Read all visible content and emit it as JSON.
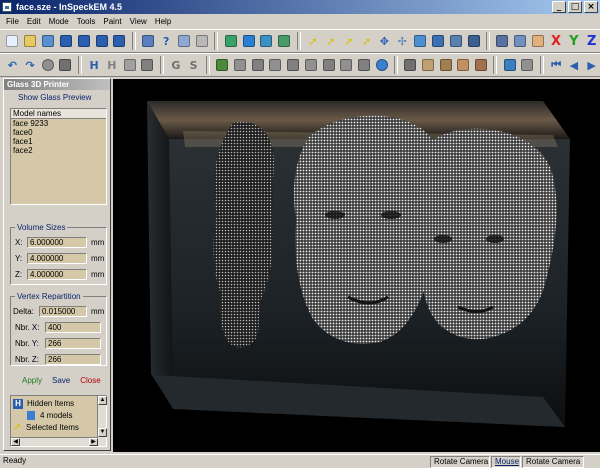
{
  "window": {
    "title": "face.sze - InSpeckEM 4.5"
  },
  "menu": [
    "File",
    "Edit",
    "Mode",
    "Tools",
    "Paint",
    "View",
    "Help"
  ],
  "axis_buttons": {
    "x": "X",
    "y": "Y",
    "z": "Z"
  },
  "toolbar_letters": {
    "h1": "H",
    "h2": "H",
    "g": "G",
    "s": "S"
  },
  "panel": {
    "title": "Glass 3D Printer",
    "show_preview": "Show Glass Preview",
    "models_header": "Model names",
    "models": [
      "face 9233",
      "face0",
      "face1",
      "face2"
    ],
    "volume_label": "Volume Sizes",
    "volume": [
      {
        "axis": "X:",
        "value": "6.000000",
        "unit": "mm"
      },
      {
        "axis": "Y:",
        "value": "4.000000",
        "unit": "mm"
      },
      {
        "axis": "Z:",
        "value": "4.000000",
        "unit": "mm"
      }
    ],
    "vertex_label": "Vertex Repartition",
    "delta": {
      "label": "Delta:",
      "value": "0.015000",
      "unit": "mm"
    },
    "counts": [
      {
        "label": "Nbr. X:",
        "value": "400"
      },
      {
        "label": "Nbr. Y:",
        "value": "266"
      },
      {
        "label": "Nbr. Z:",
        "value": "266"
      }
    ],
    "apply": "Apply",
    "save": "Save",
    "close": "Close",
    "tree": {
      "hidden": "Hidden Items",
      "models": "4 models",
      "selected": "Selected Items"
    }
  },
  "status": {
    "ready": "Ready",
    "cell1": "Rotate Camera",
    "cell2": "Mouse",
    "cell3": "Rotate Camera"
  },
  "colors": {
    "title_start": "#0a246a",
    "title_end": "#a6caf0",
    "viewport": "#000000",
    "field_bg": "#d4c8a8"
  }
}
